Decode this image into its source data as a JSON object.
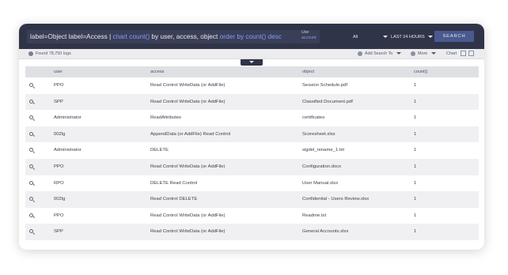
{
  "query": {
    "parts": [
      {
        "text": "label=Object label=Access | ",
        "hl": false
      },
      {
        "text": "chart count()",
        "hl": true
      },
      {
        "text": " by user, access, object ",
        "hl": false
      },
      {
        "text": "order by count() desc",
        "hl": true
      }
    ]
  },
  "use_account": {
    "line1": "Use",
    "line2": "account"
  },
  "scope_dropdown": "All",
  "time_dropdown": "LAST 24 HOURS",
  "search_button": "SEARCH",
  "found_logs": "Found 78,750 logs",
  "add_search_to": "Add Search To",
  "more": "More",
  "chart": "Chart",
  "columns": [
    "user",
    "access",
    "object",
    "count()"
  ],
  "rows": [
    {
      "user": "PPO",
      "access": "Read Control WriteData (or AddFile)",
      "object": "Session Schedule.pdf",
      "count": "1"
    },
    {
      "user": "SPP",
      "access": "Read Control WriteData (or AddFile)",
      "object": "Classified Document.pdf",
      "count": "1"
    },
    {
      "user": "Administrator",
      "access": "ReadAttributes",
      "object": "certificates",
      "count": "1"
    },
    {
      "user": "002lg",
      "access": "AppendData (or AddFile) Read Control",
      "object": "Scoresheet.xlsx",
      "count": "1"
    },
    {
      "user": "Administrator",
      "access": "DELETE",
      "object": "sigdel_rename_1.txt",
      "count": "1"
    },
    {
      "user": "PPO",
      "access": "Read Control WriteData (or AddFile)",
      "object": "Configuration.docx",
      "count": "1"
    },
    {
      "user": "RPO",
      "access": "DELETE Read Control",
      "object": "User Manual.xlsx",
      "count": "1"
    },
    {
      "user": "002lg",
      "access": "Read Control DELETE",
      "object": "Confidential - Users Review.xlsx",
      "count": "1"
    },
    {
      "user": "PPO",
      "access": "Read Control WriteData (or AddFile)",
      "object": "Readme.txt",
      "count": "1"
    },
    {
      "user": "SPP",
      "access": "Read Control WriteData (or AddFile)",
      "object": "General Accounts.xlsx",
      "count": "1"
    }
  ]
}
